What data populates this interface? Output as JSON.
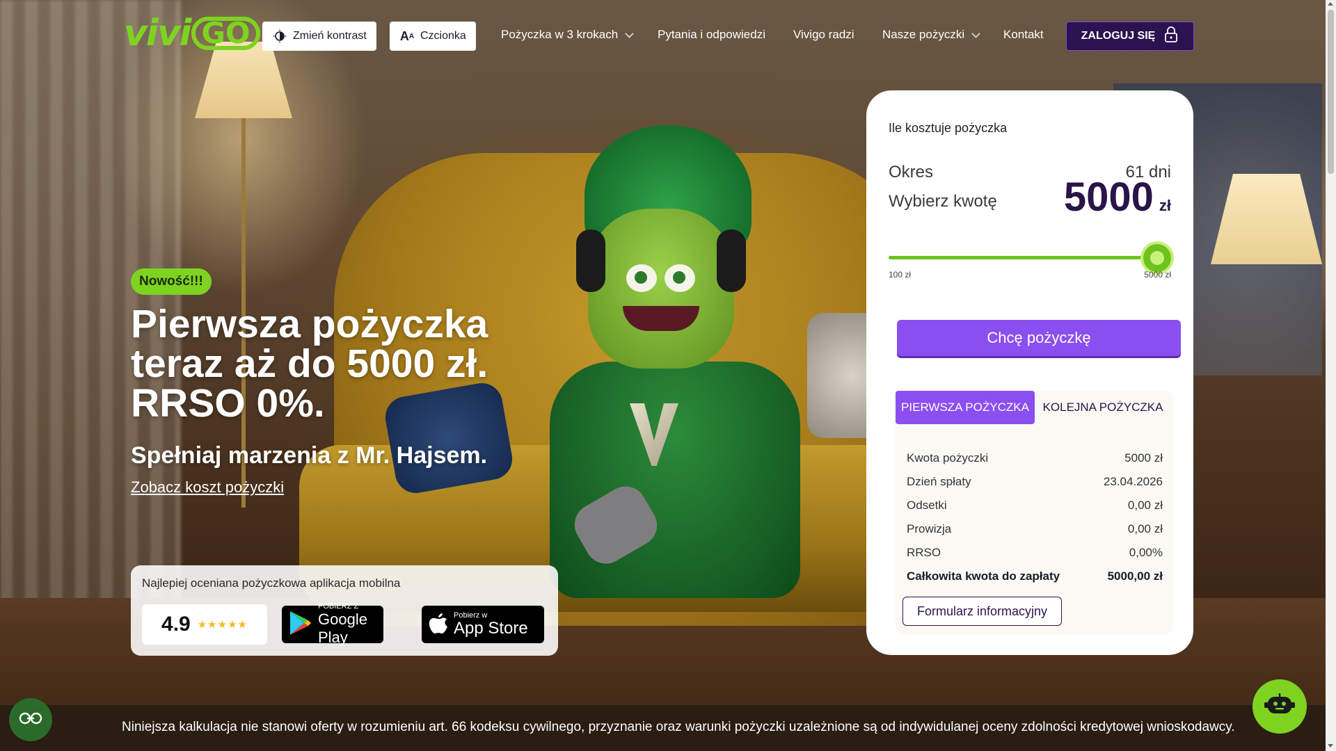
{
  "header": {
    "logo": "viviGO",
    "contrast_label": "Zmień kontrast",
    "contrast_icon": "contrast-icon",
    "font_label": "Czcionka",
    "font_icon": "font-size-icon",
    "nav": [
      {
        "label": "Pożyczka w 3 krokach",
        "dropdown": true
      },
      {
        "label": "Pytania i odpowiedzi",
        "dropdown": false
      },
      {
        "label": "Vivigo radzi",
        "dropdown": false
      },
      {
        "label": "Nasze pożyczki",
        "dropdown": true
      },
      {
        "label": "Kontakt",
        "dropdown": false
      }
    ],
    "login_label": "ZALOGUJ SIĘ",
    "login_icon": "lock-icon"
  },
  "hero": {
    "badge": "Nowość!!!",
    "title_lines": [
      "Pierwsza pożyczka",
      "teraz aż do 5000 zł.",
      "RRSO 0%."
    ],
    "subtitle": "Spełniaj marzenia z Mr. Hajsem.",
    "link": "Zobacz koszt pożyczki"
  },
  "app_card": {
    "title": "Najlepiej oceniana pożyczkowa aplikacja mobilna",
    "rating": "4.9",
    "stars": 5,
    "google_small": "POBIERZ Z",
    "google_big": "Google Play",
    "apple_small": "Pobierz w",
    "apple_big": "App Store"
  },
  "calculator": {
    "heading": "Ile kosztuje pożyczka",
    "period_label": "Okres",
    "period_value": "61 dni",
    "amount_label": "Wybierz kwotę",
    "amount_value": "5000",
    "amount_currency": "zł",
    "slider_min": "100 zł",
    "slider_max": "5000 zł",
    "slider_fraction": 1.0,
    "cta": "Chcę pożyczkę",
    "tabs": [
      {
        "label": "PIERWSZA POŻYCZKA",
        "active": true
      },
      {
        "label": "KOLEJNA POŻYCZKA",
        "active": false
      }
    ],
    "rows": [
      {
        "label": "Kwota pożyczki",
        "value": "5000 zł"
      },
      {
        "label": "Dzień spłaty",
        "value": "23.04.2026"
      },
      {
        "label": "Odsetki",
        "value": "0,00 zł"
      },
      {
        "label": "Prowizja",
        "value": "0,00 zł"
      },
      {
        "label": "RRSO",
        "value": "0,00%"
      },
      {
        "label": "Całkowita kwota do zapłaty",
        "value": "5000,00 zł",
        "bold": true
      }
    ],
    "form_button": "Formularz informacyjny"
  },
  "footer": {
    "disclaimer": "Niniejsza kalkulacja nie stanowi oferty w rozumieniu art. 66 kodeksu cywilnego, przyznanie oraz warunki pożyczki uzależnione są od indywidulanej oceny zdolności kredytowej wnioskodawcy."
  },
  "colors": {
    "brand_green": "#7ed321",
    "brand_purple": "#8b4ef0",
    "dark_purple": "#2b1250"
  }
}
